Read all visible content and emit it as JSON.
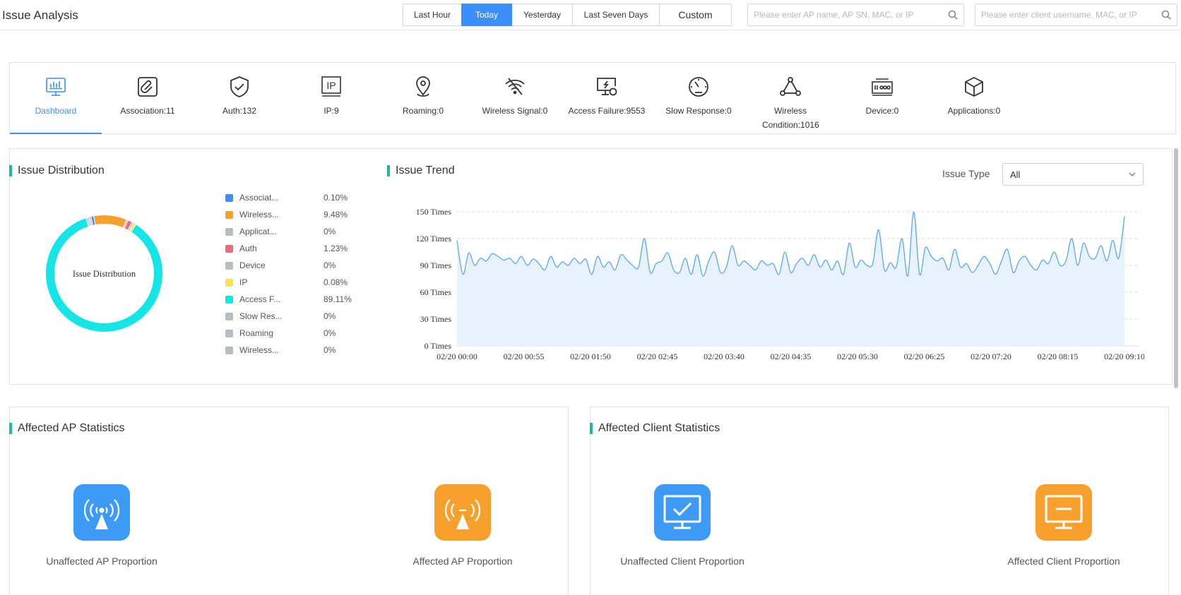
{
  "header": {
    "title": "Issue Analysis",
    "time_ranges": [
      {
        "label": "Last Hour",
        "active": false
      },
      {
        "label": "Today",
        "active": true
      },
      {
        "label": "Yesterday",
        "active": false
      },
      {
        "label": "Last Seven Days",
        "active": false
      },
      {
        "label": "Custom",
        "active": false
      }
    ],
    "ap_search_placeholder": "Please enter AP name, AP SN, MAC, or IP",
    "client_search_placeholder": "Please enter client username, MAC, or IP"
  },
  "tabs": [
    {
      "label": "Dashboard",
      "icon": "dashboard-icon",
      "active": true
    },
    {
      "label": "Association:11",
      "icon": "association-icon"
    },
    {
      "label": "Auth:132",
      "icon": "shield-check-icon"
    },
    {
      "label": "IP:9",
      "icon": "ip-icon"
    },
    {
      "label": "Roaming:0",
      "icon": "location-pin-icon"
    },
    {
      "label": "Wireless Signal:0",
      "icon": "wifi-off-icon"
    },
    {
      "label": "Access Failure:9553",
      "icon": "access-failure-icon"
    },
    {
      "label": "Slow Response:0",
      "icon": "gauge-icon"
    },
    {
      "label": "Wireless Condition:1016",
      "icon": "network-nodes-icon"
    },
    {
      "label": "Device:0",
      "icon": "device-icon"
    },
    {
      "label": "Applications:0",
      "icon": "cube-icon"
    }
  ],
  "distribution": {
    "title": "Issue Distribution",
    "center_label": "Issue Distribution",
    "legend": [
      {
        "name": "Associat...",
        "percent": "0.10%",
        "value": 0.1,
        "color": "#3d8ef8"
      },
      {
        "name": "Wireless...",
        "percent": "9.48%",
        "value": 9.48,
        "color": "#f7a02e"
      },
      {
        "name": "Applicat...",
        "percent": "0%",
        "value": 0,
        "color": "#b4bcc4"
      },
      {
        "name": "Auth",
        "percent": "1.23%",
        "value": 1.23,
        "color": "#f0687a"
      },
      {
        "name": "Device",
        "percent": "0%",
        "value": 0,
        "color": "#b4bcc4"
      },
      {
        "name": "IP",
        "percent": "0.08%",
        "value": 0.08,
        "color": "#fbe25a"
      },
      {
        "name": "Access F...",
        "percent": "89.11%",
        "value": 89.11,
        "color": "#16e5e8"
      },
      {
        "name": "Slow Res...",
        "percent": "0%",
        "value": 0,
        "color": "#b4bcc4"
      },
      {
        "name": "Roaming",
        "percent": "0%",
        "value": 0,
        "color": "#b4bcc4"
      },
      {
        "name": "Wireless...",
        "percent": "0%",
        "value": 0,
        "color": "#b4bcc4"
      }
    ]
  },
  "trend": {
    "title": "Issue Trend",
    "issue_type_label": "Issue Type",
    "issue_type_value": "All"
  },
  "chart_data": {
    "type": "area",
    "ylim": [
      0,
      150
    ],
    "y_ticks": [
      0,
      30,
      60,
      90,
      120,
      150
    ],
    "y_tick_labels": [
      "0 Times",
      "30 Times",
      "60 Times",
      "90 Times",
      "120 Times",
      "150 Times"
    ],
    "x_tick_labels": [
      "02/20 00:00",
      "02/20 00:55",
      "02/20 01:50",
      "02/20 02:45",
      "02/20 03:40",
      "02/20 04:35",
      "02/20 05:30",
      "02/20 06:25",
      "02/20 07:20",
      "02/20 08:15",
      "02/20 09:10"
    ],
    "grid": "horizontal dashed",
    "line_color": "#5aa7ef",
    "fill_color": "#e8f2fd",
    "values": [
      118,
      80,
      104,
      90,
      98,
      95,
      103,
      100,
      96,
      98,
      92,
      100,
      90,
      97,
      92,
      85,
      100,
      88,
      94,
      90,
      98,
      92,
      97,
      80,
      100,
      88,
      94,
      85,
      102,
      96,
      90,
      88,
      120,
      82,
      92,
      95,
      104,
      85,
      82,
      98,
      80,
      102,
      78,
      95,
      105,
      82,
      88,
      112,
      90,
      95,
      90,
      85,
      95,
      90,
      92,
      80,
      105,
      82,
      92,
      98,
      90,
      102,
      88,
      96,
      85,
      95,
      80,
      115,
      88,
      96,
      90,
      92,
      130,
      85,
      93,
      88,
      120,
      78,
      150,
      80,
      110,
      100,
      95,
      98,
      85,
      108,
      88,
      92,
      82,
      90,
      100,
      92,
      80,
      95,
      108,
      82,
      95,
      100,
      90,
      85,
      96,
      92,
      105,
      90,
      95,
      120,
      90,
      115,
      100,
      98,
      112,
      95,
      118,
      98,
      145
    ]
  },
  "ap_stats": {
    "title": "Affected AP Statistics",
    "unaffected_label": "Unaffected AP Proportion",
    "affected_label": "Affected AP Proportion",
    "unaffected_color": "#3d9bf6",
    "affected_color": "#f7a02e"
  },
  "client_stats": {
    "title": "Affected Client Statistics",
    "unaffected_label": "Unaffected Client Proportion",
    "affected_label": "Affected Client Proportion",
    "unaffected_color": "#3d9bf6",
    "affected_color": "#f7a02e"
  }
}
